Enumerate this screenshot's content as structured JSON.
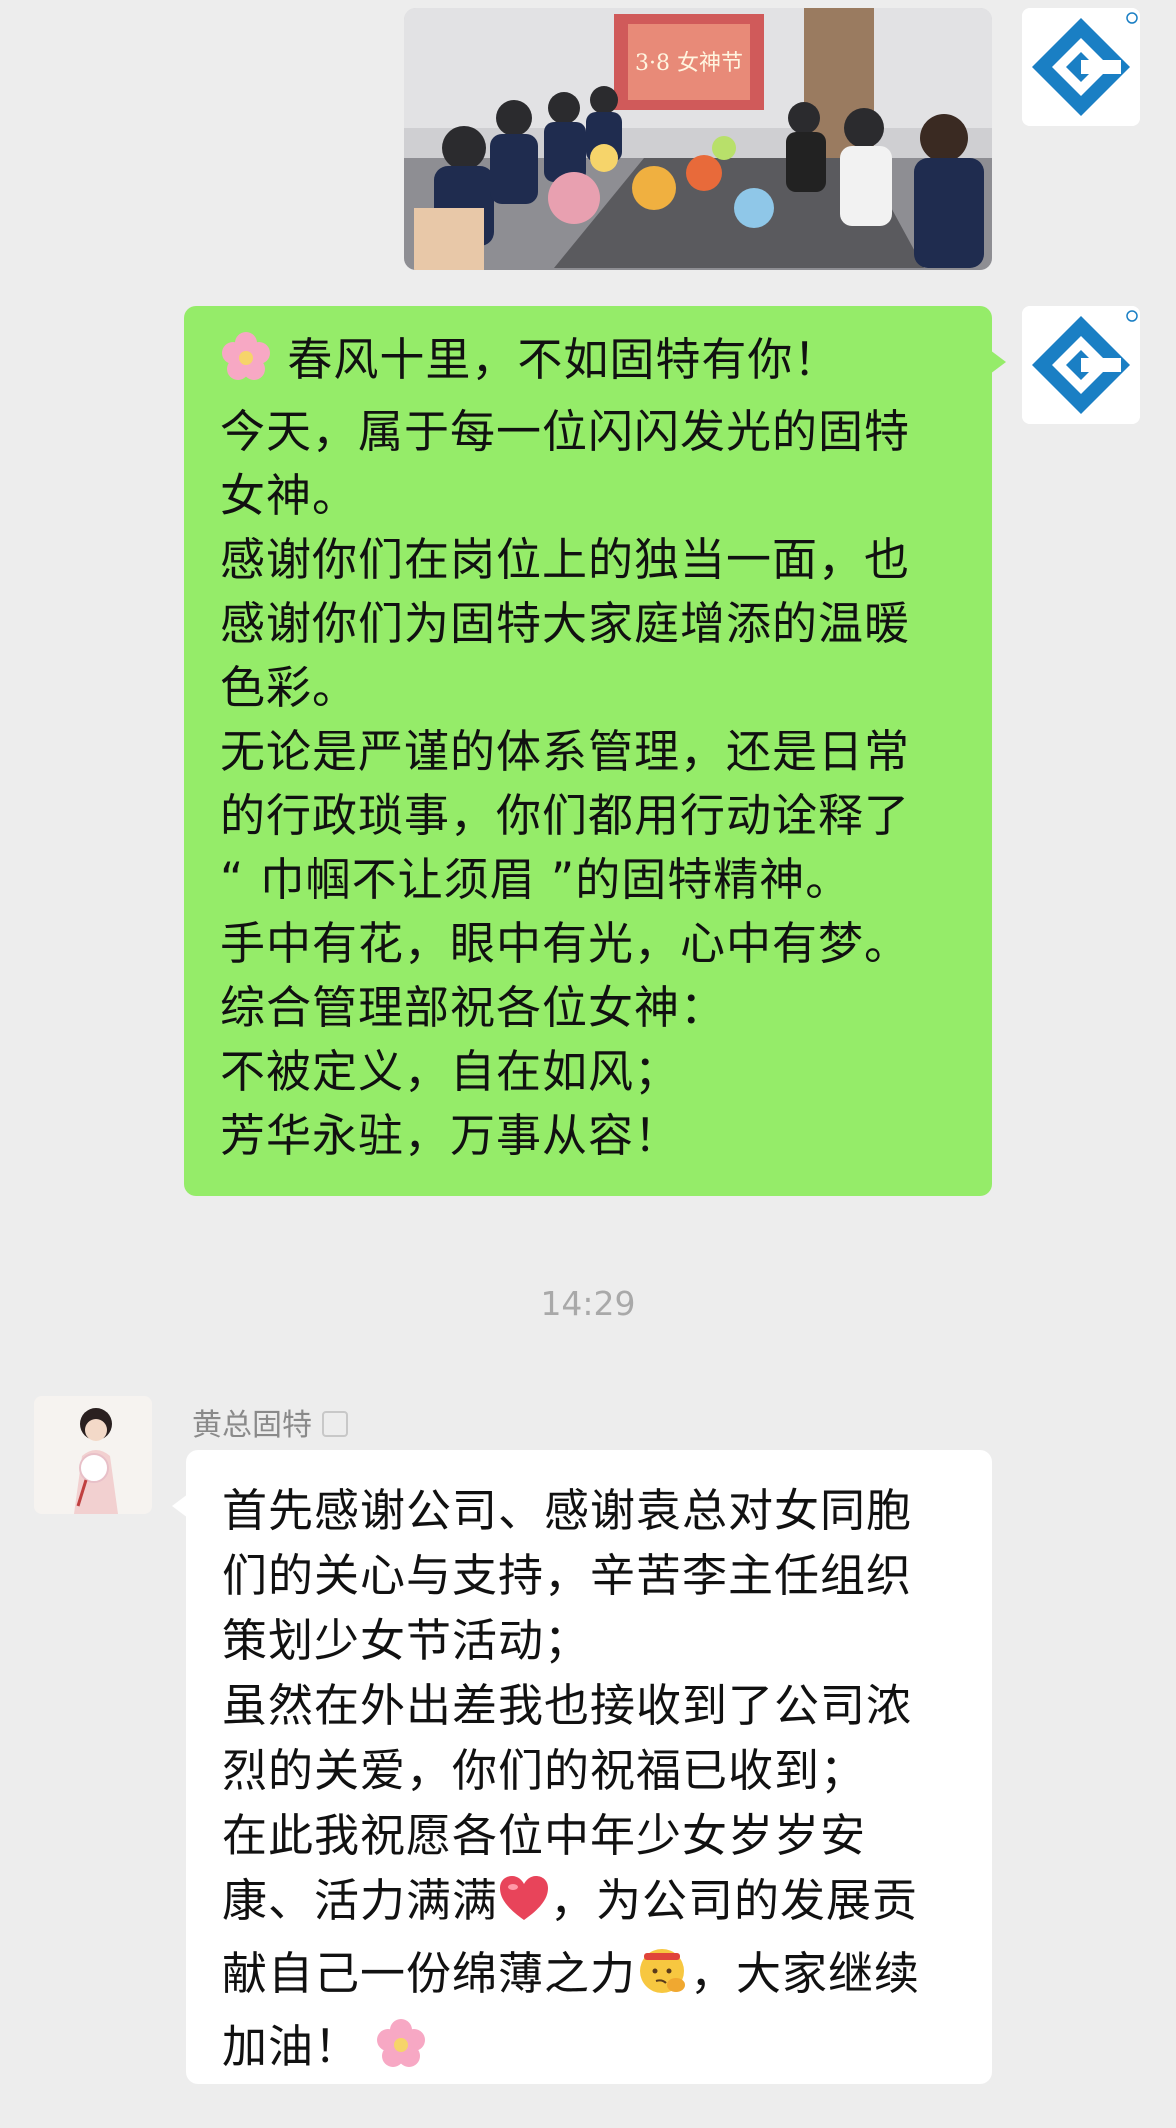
{
  "messages": {
    "sent_logo_alt": "固特 logo",
    "green_bubble": {
      "lines": [
        "春风十里，不如固特有你！",
        "今天，属于每一位闪闪发光的固特",
        "女神。",
        "感谢你们在岗位上的独当一面，也",
        "感谢你们为固特大家庭增添的温暖",
        "色彩。",
        "无论是严谨的体系管理，还是日常",
        "的行政琐事，你们都用行动诠释了",
        "“ 巾帼不让须眉 ”的固特精神。",
        "手中有花，眼中有光，心中有梦。",
        "综合管理部祝各位女神：",
        "不被定义，自在如风；",
        "芳华永驻，万事从容！"
      ]
    },
    "timestamp": "14:29",
    "sender_name": "黄总固特",
    "white_bubble": {
      "line_1": "首先感谢公司、感谢袁总对女同胞",
      "line_2": "们的关心与支持，辛苦李主任组织",
      "line_3": "策划少女节活动；",
      "line_4": "虽然在外出差我也接收到了公司浓",
      "line_5": "烈的关爱，你们的祝福已收到；",
      "line_6": "在此我祝愿各位中年少女岁岁安",
      "line_7a": "康、活力满满",
      "line_7b": "，为公司的发展贡",
      "line_8a": "献自己一份绵薄之力",
      "line_8b": "，大家继续",
      "line_9": "加油！"
    },
    "photo_banner_text": "3·8 女神节"
  },
  "colors": {
    "background": "#ededed",
    "green_bubble": "#95ec69",
    "white_bubble": "#ffffff",
    "logo_blue": "#1a7fc4"
  },
  "icons": [
    "flower-emoji-icon",
    "heart-emoji-icon",
    "salute-emoji-icon",
    "company-logo-icon"
  ]
}
